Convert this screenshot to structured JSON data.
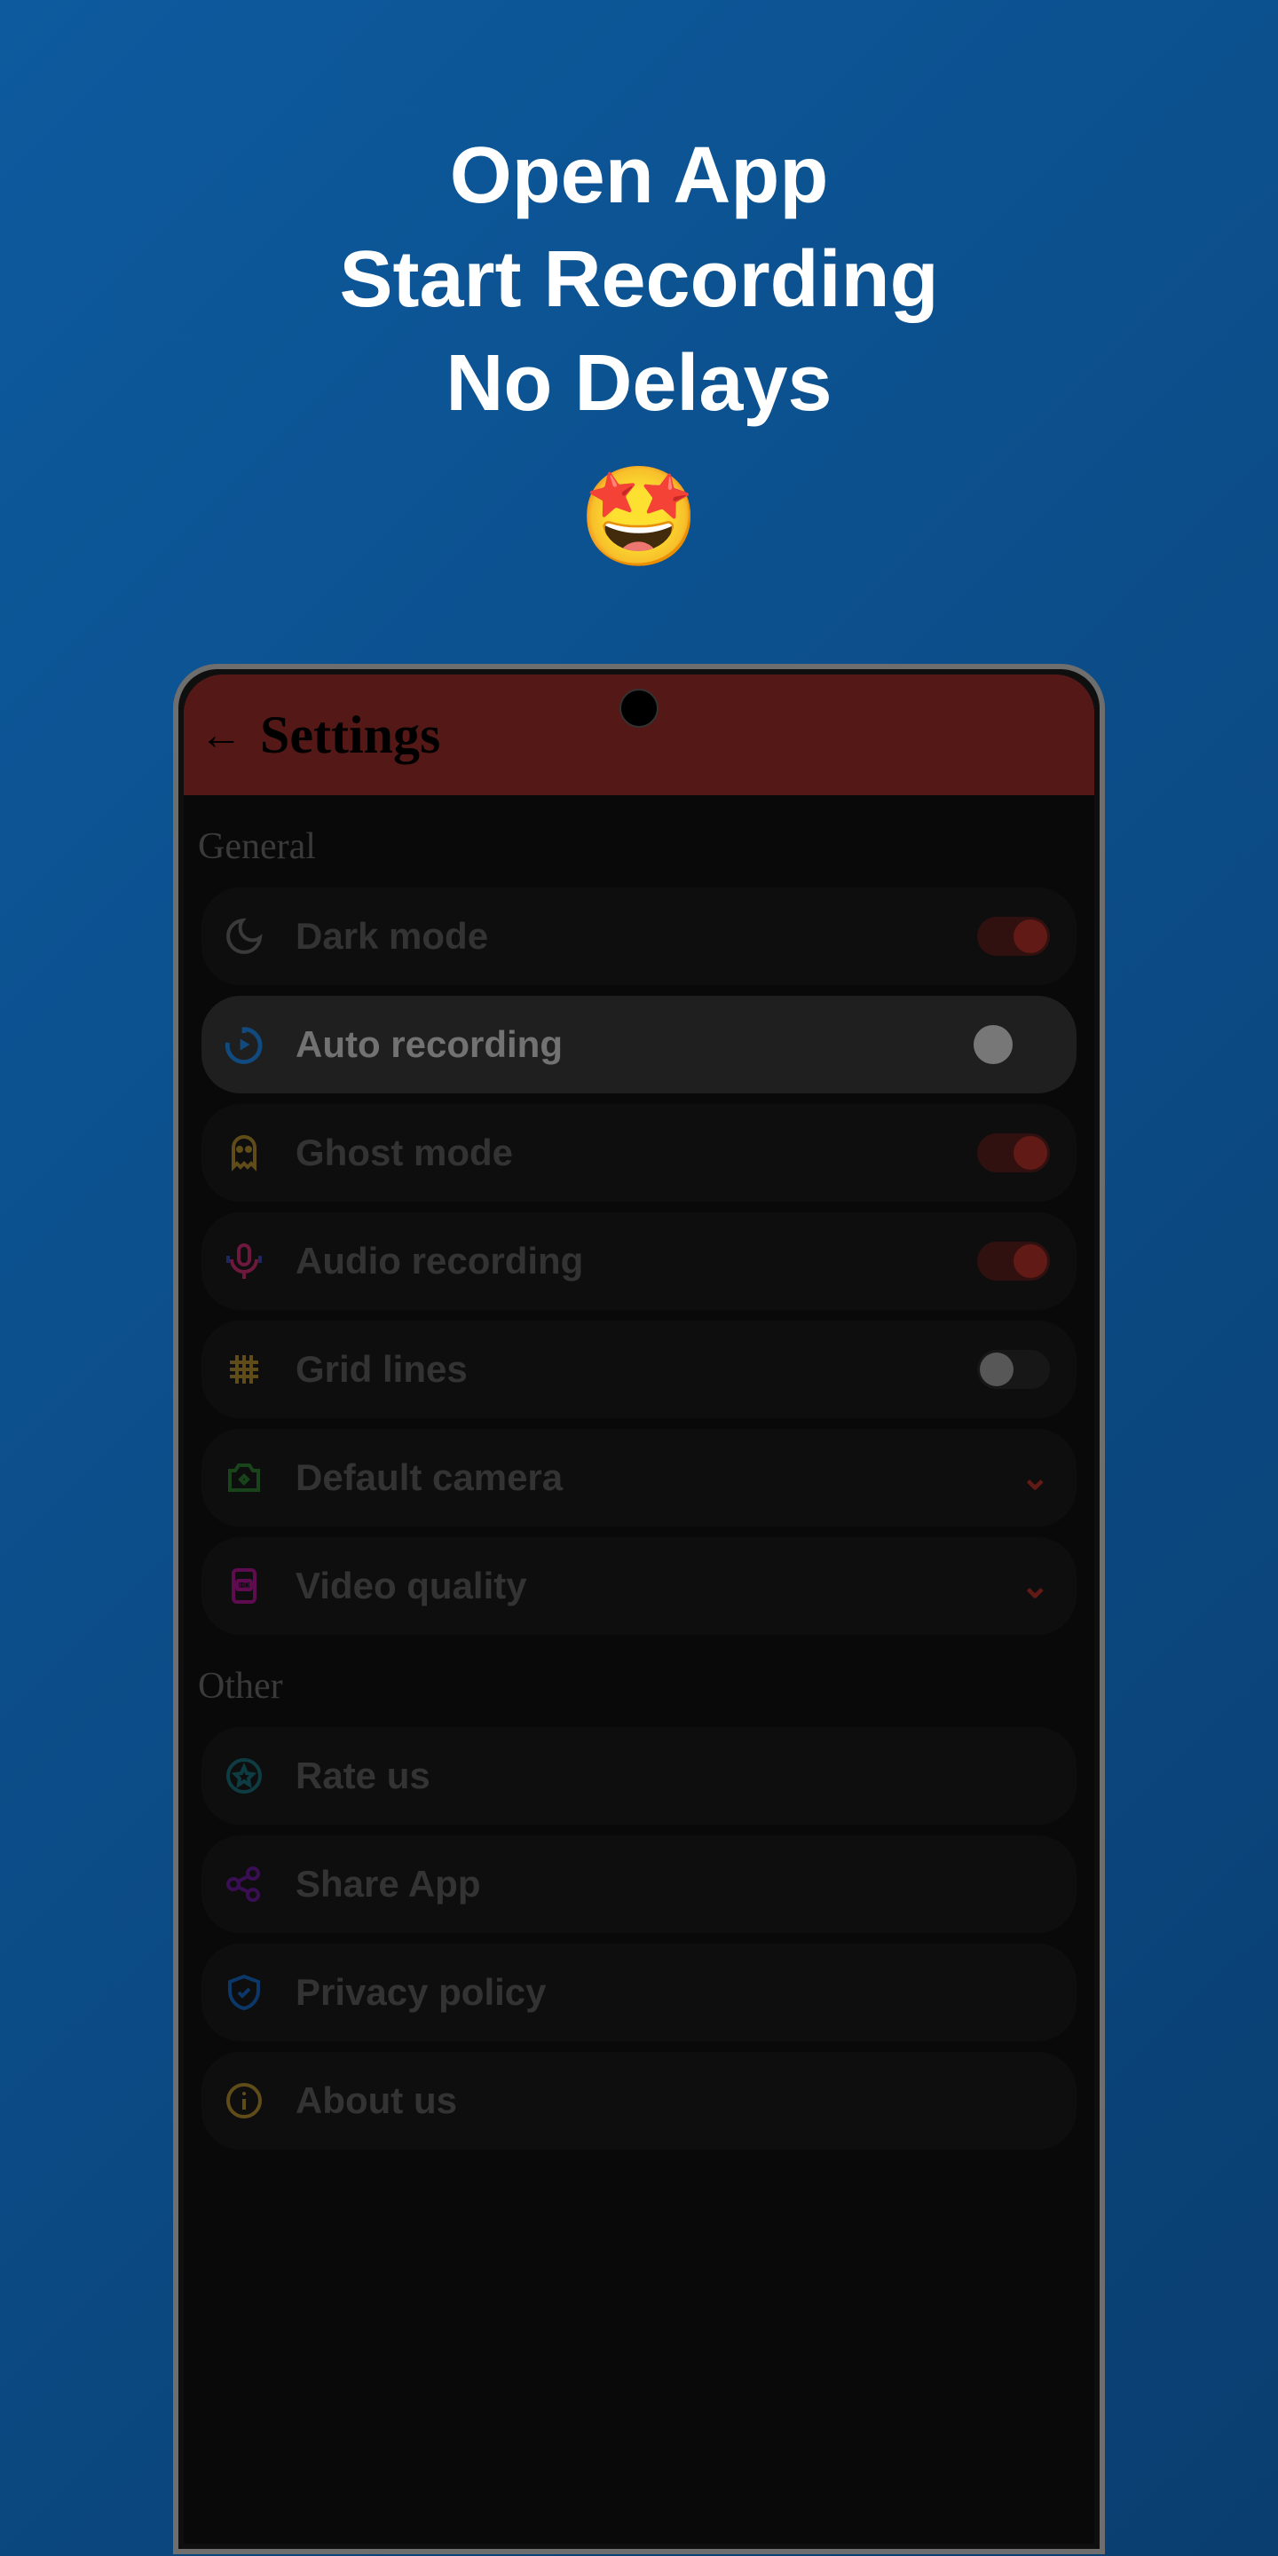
{
  "hero": {
    "line1": "Open App",
    "line2": "Start Recording",
    "line3": "No Delays",
    "emoji": "🤩"
  },
  "appbar": {
    "back_glyph": "←",
    "title": "Settings"
  },
  "sections": {
    "general_label": "General",
    "other_label": "Other"
  },
  "rows": {
    "dark_mode": {
      "label": "Dark mode",
      "on": true
    },
    "auto_recording": {
      "label": "Auto recording",
      "on": false
    },
    "ghost_mode": {
      "label": "Ghost mode",
      "on": true
    },
    "audio_recording": {
      "label": "Audio recording",
      "on": true
    },
    "grid_lines": {
      "label": "Grid lines",
      "on": false
    },
    "default_camera": {
      "label": "Default camera"
    },
    "video_quality": {
      "label": "Video quality"
    },
    "rate_us": {
      "label": "Rate us"
    },
    "share_app": {
      "label": "Share App"
    },
    "privacy_policy": {
      "label": "Privacy policy"
    },
    "about_us": {
      "label": "About us"
    }
  },
  "colors": {
    "accent_red": "#b33028",
    "appbar_bg": "#9a2f2a",
    "highlight_bg": "#3a3a3a",
    "row_bg": "#1b1b1b"
  }
}
